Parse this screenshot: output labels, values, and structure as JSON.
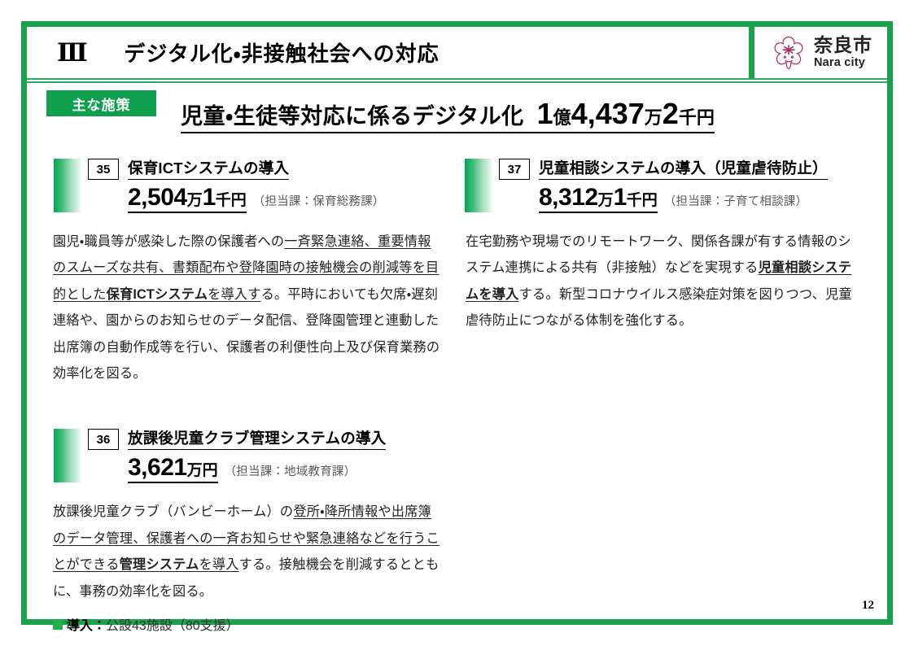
{
  "header": {
    "chapter_numeral": "Ⅲ",
    "title": "デジタル化・非接触社会への対応",
    "logo": {
      "jp": "奈良市",
      "en": "Nara city",
      "mark_color": "#B02A63"
    }
  },
  "title_block": {
    "badge": "主な施策",
    "heading": "児童・生徒等対応に係るデジタル化",
    "amount_oku_num": "1",
    "amount_oku_unit": "億",
    "amount_man_num": "4,437",
    "amount_man_unit": "万",
    "amount_sen_num": "2",
    "amount_sen_unit": "千円"
  },
  "items": [
    {
      "number": "35",
      "title": "保育ICTシステムの導入",
      "amount_num": "2,504",
      "amount_unit1": "万",
      "amount_num2": "1",
      "amount_unit2": "千円",
      "dept": "（担当課：保育総務課）",
      "body": {
        "p1": "園児・職員等が感染した際の保護者への",
        "u1": "一斉緊急連絡、重要情報のスムーズな共有、書類配布や登降園時の接触機会の削減等を目的とした",
        "ub1": "保育ICTシステム",
        "u2": "を導入す",
        "p2": "る。平時においても欠席・遅刻連絡や、園からのお知らせのデータ配信、登降園管理と連動した出席簿の自動作成等を行い、保護者の利便性向上及び保育業務の効率化を図る。"
      }
    },
    {
      "number": "36",
      "title": "放課後児童クラブ管理システムの導入",
      "amount_num": "3,621",
      "amount_unit1": "万円",
      "amount_num2": "",
      "amount_unit2": "",
      "dept": "（担当課：地域教育課）",
      "body": {
        "p1": "放課後児童クラブ（バンビーホーム）の",
        "u1": "登所・降所情報や出席簿のデータ管理、保護者への一斉お知らせや緊急連絡などを行うことができる",
        "ub1": "管理システム",
        "u2": "を導入",
        "p2": "する。接触機会を削減するとともに、事務の効率化を図る。"
      },
      "note_lead": "導入：",
      "note_text": "公設43施設（80支援）"
    },
    {
      "number": "37",
      "title": "児童相談システムの導入（児童虐待防止）",
      "amount_num": "8,312",
      "amount_unit1": "万",
      "amount_num2": "1",
      "amount_unit2": "千円",
      "dept": "（担当課：子育て相談課）",
      "body": {
        "p1": "在宅勤務や現場でのリモートワーク、関係各課が有する情報のシステム連携による共有（非接触）などを実現する",
        "u1": "",
        "ub1": "児童相談システムを導入",
        "u2": "",
        "p2": "する。新型コロナウイルス感染症対策を図りつつ、児童虐待防止につながる体制を強化する。"
      }
    }
  ],
  "page_number": "12"
}
